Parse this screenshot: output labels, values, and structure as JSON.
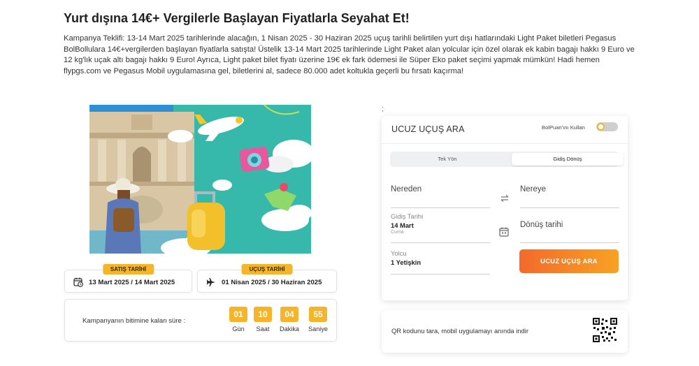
{
  "page": {
    "title": "Yurt dışına 14€+ Vergilerle Başlayan Fiyatlarla Seyahat Et!",
    "description": "Kampanya Teklifi: 13-14 Mart 2025 tarihlerinde alacağın, 1 Nisan 2025 - 30 Haziran 2025 uçuş tarihli belirtilen yurt dışı hatlarındaki Light Paket biletleri Pegasus BolBollulara 14€+vergilerden başlayan fiyatlarla satışta! Üstelik 13-14 Mart 2025 tarihlerinde Light Paket alan yolcular için özel olarak ek kabin bagajı hakkı 9 Euro ve 12 kg'lık uçak altı bagajı hakkı 9 Euro! Ayrıca, Light paket bilet fiyatı üzerine 19€ ek fark ödemesi ile Süper Eko paket seçimi yapmak mümkün! Hadi hemen flypgs.com ve Pegasus Mobil uygulamasına gel, biletlerini al, sadece 80.000 adet koltukla geçerli bu fırsatı kaçırma!"
  },
  "dates": {
    "sale": {
      "badge": "SATIŞ TARİHİ",
      "value": "13 Mart 2025 / 14 Mart 2025",
      "icon": "calendar-clock-icon"
    },
    "flight": {
      "badge": "UÇUŞ TARİHİ",
      "value": "01 Nisan 2025 / 30 Haziran 2025",
      "icon": "airplane-icon"
    }
  },
  "countdown": {
    "label": "Kampanyanın bitimine kalan süre :",
    "units": [
      {
        "value": "01",
        "caption": "Gün"
      },
      {
        "value": "10",
        "caption": "Saat"
      },
      {
        "value": "04",
        "caption": "Dakika"
      },
      {
        "value": "55",
        "caption": "Saniye"
      }
    ]
  },
  "stray_mark": ";",
  "search": {
    "title": "UCUZ UÇUŞ ARA",
    "bolpuan_label": "BolPuan'ını Kullan",
    "bolpuan_enabled": false,
    "trip_types": {
      "one_way": "Tek Yön",
      "round_trip": "Gidiş Dönüş",
      "selected": "round_trip"
    },
    "from_label": "Nereden",
    "to_label": "Nereye",
    "departure": {
      "label": "Gidiş Tarihi",
      "date": "14 Mart",
      "weekday": "Cuma"
    },
    "return_label": "Dönüş tarihi",
    "passengers": {
      "label": "Yolcu",
      "value": "1 Yetişkin"
    },
    "button": "UCUZ UÇUŞ ARA"
  },
  "qr": {
    "text": "QR kodunu tara, mobil uygulamayı anında indir"
  },
  "colors": {
    "accent": "#f5b52a",
    "button_start": "#f26a2b",
    "button_end": "#f7a224",
    "hero_bg": "#3fbfb0"
  }
}
